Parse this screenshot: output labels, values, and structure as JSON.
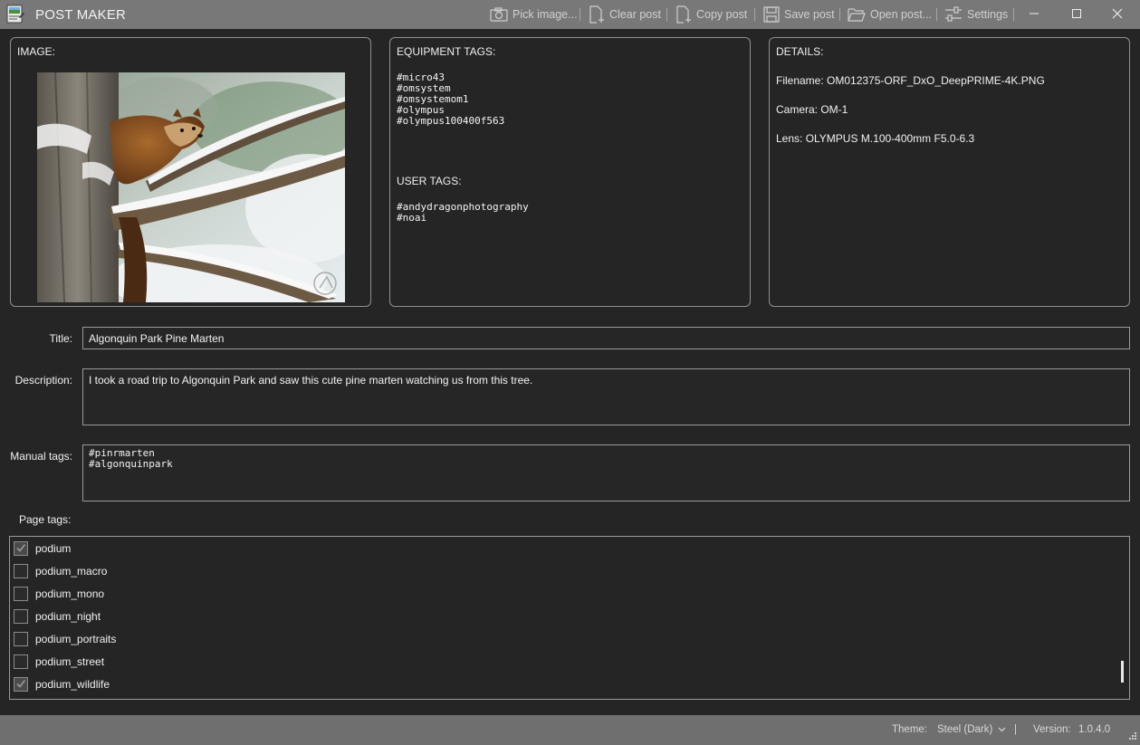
{
  "titlebar": {
    "app_title": "POST MAKER",
    "buttons": {
      "pick_image": "Pick image...",
      "clear_post": "Clear post",
      "copy_post": "Copy post",
      "save_post": "Save post",
      "open_post": "Open post...",
      "settings": "Settings"
    }
  },
  "image_panel": {
    "label": "IMAGE:"
  },
  "equipment_panel": {
    "label": "EQUIPMENT TAGS:",
    "equipment_tags": "#micro43\n#omsystem\n#omsystemom1\n#olympus\n#olympus100400f563",
    "user_tags_label": "USER TAGS:",
    "user_tags": "#andydragonphotography\n#noai"
  },
  "details_panel": {
    "label": "DETAILS:",
    "filename": "Filename: OM012375-ORF_DxO_DeepPRIME-4K.PNG",
    "camera": "Camera: OM-1",
    "lens": "Lens: OLYMPUS M.100-400mm F5.0-6.3"
  },
  "form": {
    "title_label": "Title:",
    "title_value": "Algonquin Park Pine Marten",
    "description_label": "Description:",
    "description_value": "I took a road trip to Algonquin Park and saw this cute pine marten watching us from this tree.",
    "manual_tags_label": "Manual tags:",
    "manual_tags_value": "#pinrmarten\n#algonquinpark",
    "page_tags_label": "Page tags:"
  },
  "page_tags": [
    {
      "label": "podium",
      "checked": true
    },
    {
      "label": "podium_macro",
      "checked": false
    },
    {
      "label": "podium_mono",
      "checked": false
    },
    {
      "label": "podium_night",
      "checked": false
    },
    {
      "label": "podium_portraits",
      "checked": false
    },
    {
      "label": "podium_street",
      "checked": false
    },
    {
      "label": "podium_wildlife",
      "checked": true
    }
  ],
  "statusbar": {
    "theme_label": "Theme:",
    "theme_value": "Steel (Dark)",
    "separator": "|",
    "version_label": "Version:",
    "version_value": "1.0.4.0"
  },
  "colors": {
    "titlebar_bg": "#787878",
    "window_bg": "#252525",
    "border": "#8f8f8f",
    "statusbar_bg": "#6f6f6f"
  },
  "icons": [
    "app-icon",
    "camera-icon",
    "clear-post-icon",
    "copy-post-icon",
    "save-icon",
    "folder-open-icon",
    "settings-sliders-icon",
    "minimize-icon",
    "maximize-icon",
    "close-icon",
    "checkmark-icon",
    "chevron-down-icon",
    "resize-grip-icon"
  ]
}
